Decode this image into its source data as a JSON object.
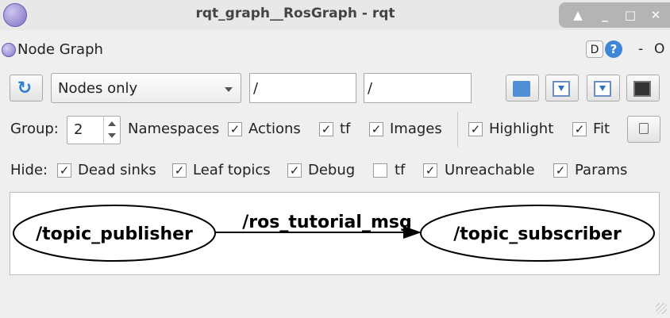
{
  "window": {
    "title": "rqt_graph__RosGraph - rqt",
    "controls": [
      "▲",
      "_",
      "□",
      "✕"
    ]
  },
  "panel": {
    "title": "Node Graph",
    "d_label": "D",
    "help_label": "?",
    "dash_label": "-",
    "o_label": "O"
  },
  "toolbar": {
    "refresh_icon": "refresh-icon",
    "mode_value": "Nodes only",
    "ns_filter_value": "/",
    "topic_filter_value": "/"
  },
  "options": {
    "group_label": "Group:",
    "group_value": "2",
    "namespaces_label": "Namespaces",
    "actions_label": "Actions",
    "actions_checked": true,
    "tf_label": "tf",
    "tf_checked": true,
    "images_label": "Images",
    "images_checked": true,
    "highlight_label": "Highlight",
    "highlight_checked": true,
    "fit_label": "Fit",
    "fit_checked": true
  },
  "hide": {
    "label": "Hide:",
    "dead_sinks_label": "Dead sinks",
    "dead_sinks_checked": true,
    "leaf_topics_label": "Leaf topics",
    "leaf_topics_checked": true,
    "debug_label": "Debug",
    "debug_checked": true,
    "tf_label": "tf",
    "tf_checked": false,
    "unreachable_label": "Unreachable",
    "unreachable_checked": true,
    "params_label": "Params",
    "params_checked": true
  },
  "graph": {
    "source_node": "/topic_publisher",
    "target_node": "/topic_subscriber",
    "edge_label": "/ros_tutorial_msg"
  },
  "colors": {
    "accent": "#3f86d8",
    "folder": "#4f8fd6"
  }
}
